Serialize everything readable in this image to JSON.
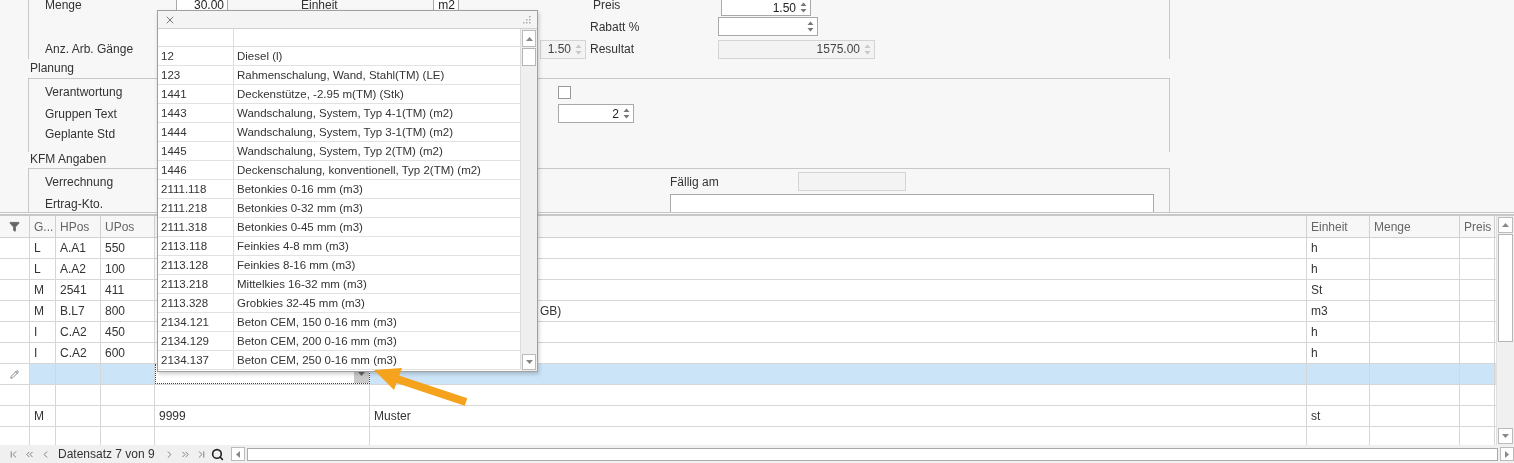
{
  "costing": {
    "menge_label": "Menge",
    "menge_value": "30.00",
    "einheit_label": "Einheit",
    "einheit_value": "m2",
    "preis_label": "Preis",
    "preis_value": "1.50",
    "rabatt_label": "Rabatt %",
    "arbeitsgaenge_label": "Anz. Arb. Gänge",
    "arbeitsgaenge_value": "1.50",
    "resultat_label": "Resultat",
    "resultat_value": "1575.00"
  },
  "planung": {
    "title": "Planung",
    "verantwortung_label": "Verantwortung",
    "verantwortung_checked": false,
    "gruppen_label": "Gruppen Text",
    "gruppen_value": "2",
    "geplante_label": "Geplante Std"
  },
  "kfm": {
    "title": "KFM Angaben",
    "verrechnung_label": "Verrechnung",
    "ertrag_label": "Ertrag-Kto.",
    "faellig_label": "Fällig am"
  },
  "grid": {
    "columns": [
      {
        "label": "G..."
      },
      {
        "label": "HPos"
      },
      {
        "label": "UPos"
      },
      {},
      {},
      {
        "label": "Einheit"
      },
      {
        "label": "Menge"
      },
      {
        "label": "Preis"
      }
    ],
    "rows": [
      {
        "g": "L",
        "hpos": "A.A1",
        "upos": "550",
        "einheit": "h",
        "selected": false
      },
      {
        "g": "L",
        "hpos": "A.A2",
        "upos": "100",
        "einheit": "h",
        "selected": false
      },
      {
        "g": "M",
        "hpos": "2541",
        "upos": "411",
        "einheit": "St",
        "selected": false
      },
      {
        "g": "M",
        "hpos": "B.L7",
        "upos": "800",
        "column_5": "GB)",
        "column_5_partly_covered": true,
        "einheit": "m3",
        "selected": false
      },
      {
        "g": "I",
        "hpos": "C.A2",
        "upos": "450",
        "einheit": "h",
        "selected": false
      },
      {
        "g": "I",
        "hpos": "C.A2",
        "upos": "600",
        "einheit": "h",
        "selected": false
      },
      {
        "selected": true,
        "editing": true
      },
      {
        "selected": false
      },
      {
        "g": "M",
        "column_4": "9999",
        "column_5": "Muster",
        "einheit": "st",
        "selected": false
      },
      {
        "selected": false
      }
    ]
  },
  "lookup_popup": {
    "rows": [
      {
        "code": "12",
        "name": "Diesel (l)"
      },
      {
        "code": "123",
        "name": "Rahmenschalung, Wand, Stahl(TM) (LE)"
      },
      {
        "code": "1441",
        "name": "Deckenstütze, -2.95 m(TM) (Stk)"
      },
      {
        "code": "1443",
        "name": "Wandschalung, System, Typ 4-1(TM) (m2)"
      },
      {
        "code": "1444",
        "name": "Wandschalung, System, Typ 3-1(TM) (m2)"
      },
      {
        "code": "1445",
        "name": "Wandschalung, System, Typ 2(TM) (m2)"
      },
      {
        "code": "1446",
        "name": "Deckenschalung, konventionell, Typ 2(TM) (m2)"
      },
      {
        "code": "2111.118",
        "name": "Betonkies 0-16 mm (m3)"
      },
      {
        "code": "2111.218",
        "name": "Betonkies 0-32 mm (m3)"
      },
      {
        "code": "2111.318",
        "name": "Betonkies 0-45 mm (m3)"
      },
      {
        "code": "2113.118",
        "name": "Feinkies 4-8 mm (m3)"
      },
      {
        "code": "2113.128",
        "name": "Feinkies 8-16 mm (m3)"
      },
      {
        "code": "2113.218",
        "name": "Mittelkies 16-32 mm (m3)"
      },
      {
        "code": "2113.328",
        "name": "Grobkies 32-45 mm (m3)"
      },
      {
        "code": "2134.121",
        "name": "Beton CEM, 150  0-16 mm (m3)"
      },
      {
        "code": "2134.129",
        "name": "Beton CEM, 200  0-16 mm (m3)"
      },
      {
        "code": "2134.137",
        "name": "Beton CEM, 250  0-16 mm (m3)"
      }
    ]
  },
  "navigator": {
    "record_text": "Datensatz 7 von 9"
  }
}
